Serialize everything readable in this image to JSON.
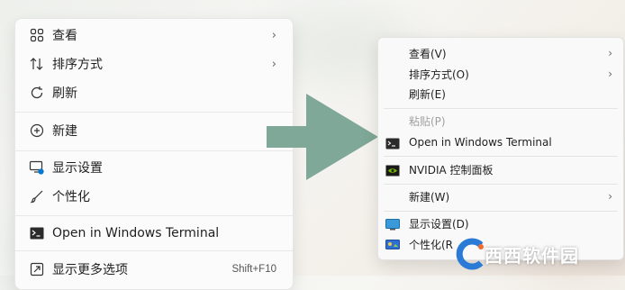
{
  "left_menu": {
    "items": [
      {
        "label": "查看",
        "icon": "grid-icon",
        "chevron": "›"
      },
      {
        "label": "排序方式",
        "icon": "sort-icon",
        "chevron": "›"
      },
      {
        "label": "刷新",
        "icon": "refresh-icon"
      },
      {
        "label": "新建",
        "icon": "plus-circle-icon",
        "chevron": "›"
      },
      {
        "label": "显示设置",
        "icon": "display-settings-icon"
      },
      {
        "label": "个性化",
        "icon": "brush-icon"
      },
      {
        "label": "Open in Windows Terminal",
        "icon": "terminal-icon"
      },
      {
        "label": "显示更多选项",
        "icon": "show-more-icon",
        "shortcut": "Shift+F10"
      }
    ]
  },
  "right_menu": {
    "items": [
      {
        "label": "查看(V)",
        "chevron": "›"
      },
      {
        "label": "排序方式(O)",
        "chevron": "›"
      },
      {
        "label": "刷新(E)"
      },
      {
        "label": "粘贴(P)",
        "disabled": true
      },
      {
        "label": "Open in Windows Terminal",
        "icon": "terminal-icon"
      },
      {
        "label": "NVIDIA 控制面板",
        "icon": "nvidia-icon"
      },
      {
        "label": "新建(W)",
        "chevron": "›"
      },
      {
        "label": "显示设置(D)",
        "icon": "display-icon"
      },
      {
        "label": "个性化(R",
        "icon": "personalize-icon"
      }
    ]
  },
  "watermark": {
    "text": "西西软件园"
  },
  "colors": {
    "arrow": "#7fa898",
    "accent": "#0078d4"
  }
}
